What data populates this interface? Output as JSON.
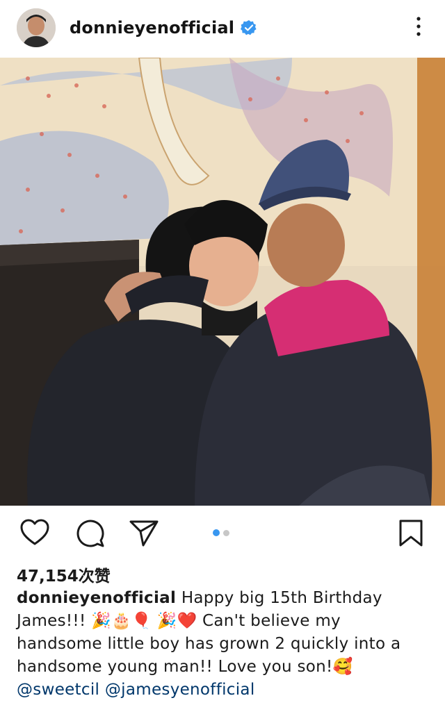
{
  "header": {
    "username": "donnieyenofficial",
    "verified_icon": "verified-badge-icon",
    "more_icon": "more-vertical-icon"
  },
  "photo": {
    "description_icon": "post-photo"
  },
  "actions": {
    "like_icon": "heart-icon",
    "comment_icon": "comment-icon",
    "share_icon": "send-icon",
    "save_icon": "bookmark-icon",
    "carousel": {
      "total": 2,
      "active": 1
    }
  },
  "likes": {
    "count_text": "47,154次赞"
  },
  "caption": {
    "username": "donnieyenofficial",
    "line1": "Happy big 15th Birthday",
    "line2": "James!!! 🎉🎂🎈 🎉❤️ Can't believe my",
    "line3": "handsome little boy has grown 2 quickly into a",
    "line4": "handsome young man!! Love you son!🥰",
    "mention1": "@sweetcil",
    "mention2": "@jamesyenofficial"
  },
  "colors": {
    "accent_blue": "#3897f0",
    "mention": "#00376b",
    "text": "#1a1a1a"
  }
}
